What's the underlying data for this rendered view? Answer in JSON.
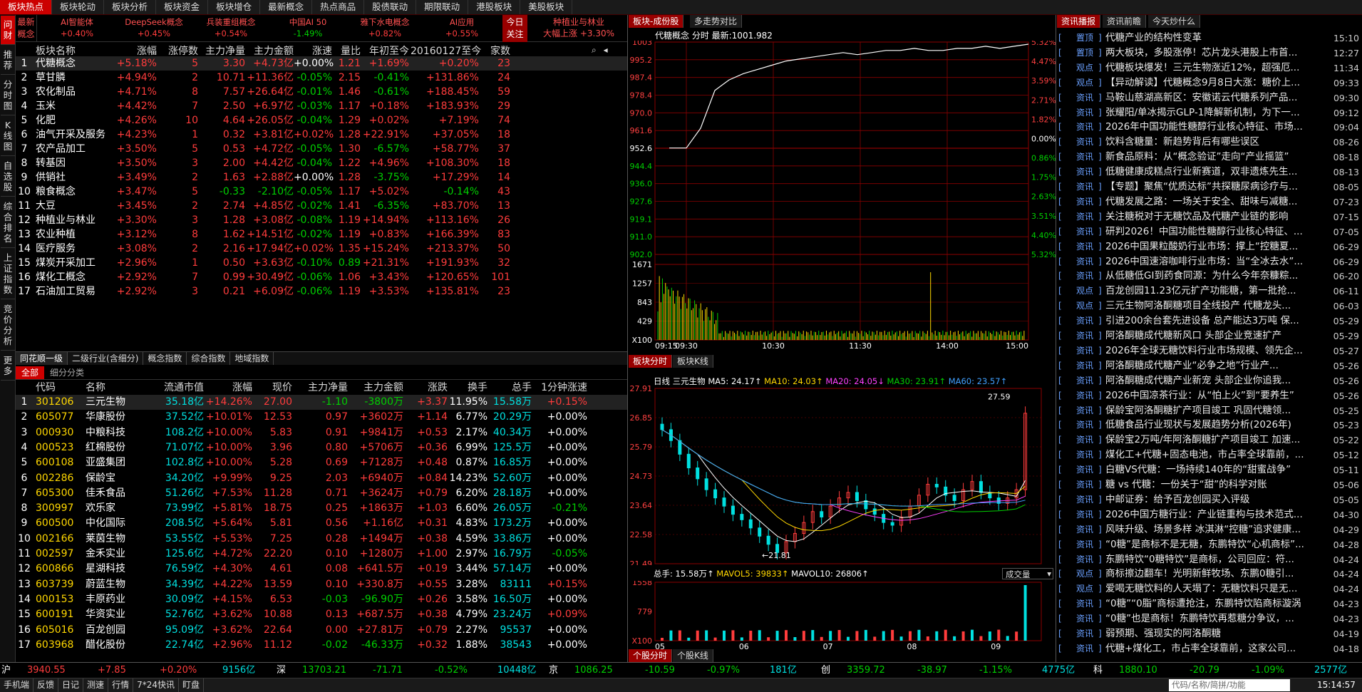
{
  "top_tabs": [
    "板块热点",
    "板块轮动",
    "板块分析",
    "板块资金",
    "板块增仓",
    "最新概念",
    "热点商品",
    "股债联动",
    "期限联动",
    "港股板块",
    "美股板块"
  ],
  "left_strip": [
    "问财",
    "推荐",
    "分时图",
    "K线图",
    "自选股",
    "综合排名",
    "上证指数",
    "竞价分析",
    "更多"
  ],
  "ticker": {
    "label": "最新概念",
    "items": [
      {
        "name": "AI智能体",
        "pct": "+0.40%"
      },
      {
        "name": "DeepSeek概念",
        "pct": "+0.45%"
      },
      {
        "name": "兵装重组概念",
        "pct": "+0.54%"
      },
      {
        "name": "中国AI 50",
        "pct": "-1.49%"
      },
      {
        "name": "雅下水电概念",
        "pct": "+0.82%"
      },
      {
        "name": "AI应用",
        "pct": "+0.55%"
      }
    ],
    "focus_label": "今日关注",
    "focus_items": [
      "种植业与林业",
      "大幅上涨 +3.30%"
    ]
  },
  "sector_table": {
    "headers": [
      "板块名称",
      "涨幅",
      "涨停数",
      "主力净量",
      "主力金额",
      "涨速",
      "量比",
      "年初至今",
      "20160127至今",
      "家数"
    ],
    "rows": [
      [
        "1",
        "代糖概念",
        "+5.18%",
        "5",
        "3.30",
        "+4.73亿",
        "+0.00%",
        "1.21",
        "+1.69%",
        "+0.20%",
        "23"
      ],
      [
        "2",
        "草甘膦",
        "+4.94%",
        "2",
        "10.71",
        "+11.36亿",
        "-0.05%",
        "2.15",
        "-0.41%",
        "+131.86%",
        "24"
      ],
      [
        "3",
        "农化制品",
        "+4.71%",
        "8",
        "7.57",
        "+26.64亿",
        "-0.01%",
        "1.46",
        "-0.61%",
        "+188.45%",
        "59"
      ],
      [
        "4",
        "玉米",
        "+4.42%",
        "7",
        "2.50",
        "+6.97亿",
        "-0.03%",
        "1.17",
        "+0.18%",
        "+183.93%",
        "29"
      ],
      [
        "5",
        "化肥",
        "+4.26%",
        "10",
        "4.64",
        "+26.05亿",
        "-0.04%",
        "1.29",
        "+0.02%",
        "+7.19%",
        "74"
      ],
      [
        "6",
        "油气开采及服务",
        "+4.23%",
        "1",
        "0.32",
        "+3.81亿",
        "+0.02%",
        "1.28",
        "+22.91%",
        "+37.05%",
        "18"
      ],
      [
        "7",
        "农产品加工",
        "+3.50%",
        "5",
        "0.53",
        "+4.72亿",
        "-0.05%",
        "1.30",
        "-6.57%",
        "+58.77%",
        "37"
      ],
      [
        "8",
        "转基因",
        "+3.50%",
        "3",
        "2.00",
        "+4.42亿",
        "-0.04%",
        "1.22",
        "+4.96%",
        "+108.30%",
        "18"
      ],
      [
        "9",
        "供销社",
        "+3.49%",
        "2",
        "1.63",
        "+2.88亿",
        "+0.00%",
        "1.28",
        "-3.75%",
        "+17.29%",
        "14"
      ],
      [
        "10",
        "粮食概念",
        "+3.47%",
        "5",
        "-0.33",
        "-2.10亿",
        "-0.05%",
        "1.17",
        "+5.02%",
        "-0.14%",
        "43"
      ],
      [
        "11",
        "大豆",
        "+3.45%",
        "2",
        "2.74",
        "+4.85亿",
        "-0.02%",
        "1.41",
        "-6.35%",
        "+83.70%",
        "13"
      ],
      [
        "12",
        "种植业与林业",
        "+3.30%",
        "3",
        "1.28",
        "+3.08亿",
        "-0.08%",
        "1.19",
        "+14.94%",
        "+113.16%",
        "26"
      ],
      [
        "13",
        "农业种植",
        "+3.12%",
        "8",
        "1.62",
        "+14.51亿",
        "-0.02%",
        "1.19",
        "+0.83%",
        "+166.39%",
        "83"
      ],
      [
        "14",
        "医疗服务",
        "+3.08%",
        "2",
        "2.16",
        "+17.94亿",
        "+0.02%",
        "1.35",
        "+15.24%",
        "+213.37%",
        "50"
      ],
      [
        "15",
        "煤炭开采加工",
        "+2.96%",
        "1",
        "0.50",
        "+3.63亿",
        "-0.10%",
        "0.89",
        "+21.31%",
        "+191.93%",
        "32"
      ],
      [
        "16",
        "煤化工概念",
        "+2.92%",
        "7",
        "0.99",
        "+30.49亿",
        "-0.06%",
        "1.06",
        "+3.43%",
        "+120.65%",
        "101"
      ],
      [
        "17",
        "石油加工贸易",
        "+2.92%",
        "3",
        "0.21",
        "+6.09亿",
        "-0.06%",
        "1.19",
        "+3.53%",
        "+135.81%",
        "23"
      ]
    ]
  },
  "sub_tabs": [
    "同花顺一级",
    "二级行业(含细分)",
    "概念指数",
    "综合指数",
    "地域指数"
  ],
  "all_tabs": [
    "全部",
    "细分分类"
  ],
  "stock_table": {
    "headers": [
      "代码",
      "名称",
      "流通市值",
      "涨幅",
      "现价",
      "主力净量",
      "主力金额",
      "涨跌",
      "换手",
      "总手",
      "1分钟涨速"
    ],
    "rows": [
      [
        "1",
        "301206",
        "三元生物",
        "35.18亿",
        "+14.26%",
        "27.00",
        "-1.10",
        "-3800万",
        "+3.37",
        "11.95%",
        "15.58万",
        "+0.15%"
      ],
      [
        "2",
        "605077",
        "华康股份",
        "37.52亿",
        "+10.01%",
        "12.53",
        "0.97",
        "+3602万",
        "+1.14",
        "6.77%",
        "20.29万",
        "+0.00%"
      ],
      [
        "3",
        "000930",
        "中粮科技",
        "108.2亿",
        "+10.00%",
        "5.83",
        "0.91",
        "+9841万",
        "+0.53",
        "2.17%",
        "40.34万",
        "+0.00%"
      ],
      [
        "4",
        "000523",
        "红棉股份",
        "71.07亿",
        "+10.00%",
        "3.96",
        "0.80",
        "+5706万",
        "+0.36",
        "6.99%",
        "125.5万",
        "+0.00%"
      ],
      [
        "5",
        "600108",
        "亚盛集团",
        "102.8亿",
        "+10.00%",
        "5.28",
        "0.69",
        "+7128万",
        "+0.48",
        "0.87%",
        "16.85万",
        "+0.00%"
      ],
      [
        "6",
        "002286",
        "保龄宝",
        "34.20亿",
        "+9.99%",
        "9.25",
        "2.03",
        "+6940万",
        "+0.84",
        "14.23%",
        "52.60万",
        "+0.00%"
      ],
      [
        "7",
        "605300",
        "佳禾食品",
        "51.26亿",
        "+7.53%",
        "11.28",
        "0.71",
        "+3624万",
        "+0.79",
        "6.20%",
        "28.18万",
        "+0.00%"
      ],
      [
        "8",
        "300997",
        "欢乐家",
        "73.99亿",
        "+5.81%",
        "18.75",
        "0.25",
        "+1863万",
        "+1.03",
        "6.60%",
        "26.05万",
        "-0.21%"
      ],
      [
        "9",
        "600500",
        "中化国际",
        "208.5亿",
        "+5.64%",
        "5.81",
        "0.56",
        "+1.16亿",
        "+0.31",
        "4.83%",
        "173.2万",
        "+0.00%"
      ],
      [
        "10",
        "002166",
        "莱茵生物",
        "53.55亿",
        "+5.53%",
        "7.25",
        "0.28",
        "+1494万",
        "+0.38",
        "4.59%",
        "33.86万",
        "+0.00%"
      ],
      [
        "11",
        "002597",
        "金禾实业",
        "125.6亿",
        "+4.72%",
        "22.20",
        "0.10",
        "+1280万",
        "+1.00",
        "2.97%",
        "16.79万",
        "-0.05%"
      ],
      [
        "12",
        "600866",
        "星湖科技",
        "76.59亿",
        "+4.30%",
        "4.61",
        "0.08",
        "+641.5万",
        "+0.19",
        "3.44%",
        "57.14万",
        "+0.00%"
      ],
      [
        "13",
        "603739",
        "蔚蓝生物",
        "34.39亿",
        "+4.22%",
        "13.59",
        "0.10",
        "+330.8万",
        "+0.55",
        "3.28%",
        "83111",
        "+0.15%"
      ],
      [
        "14",
        "000153",
        "丰原药业",
        "30.09亿",
        "+4.15%",
        "6.53",
        "-0.03",
        "-96.90万",
        "+0.26",
        "3.58%",
        "16.50万",
        "+0.00%"
      ],
      [
        "15",
        "600191",
        "华资实业",
        "52.76亿",
        "+3.62%",
        "10.88",
        "0.13",
        "+687.5万",
        "+0.38",
        "4.79%",
        "23.24万",
        "+0.09%"
      ],
      [
        "16",
        "605016",
        "百龙创园",
        "95.09亿",
        "+3.62%",
        "22.64",
        "0.00",
        "+27.81万",
        "+0.79",
        "2.27%",
        "95537",
        "+0.00%"
      ],
      [
        "17",
        "603968",
        "醋化股份",
        "22.74亿",
        "+2.96%",
        "11.12",
        "-0.02",
        "-46.33万",
        "+0.32",
        "1.88%",
        "38543",
        "+0.00%"
      ]
    ]
  },
  "chart_panel": {
    "tabs_top": [
      "板块-成份股",
      "多走势对比"
    ],
    "intraday_title": "代糖概念 分时 最新:1001.982",
    "tabs_mid": [
      "板块分时",
      "板块K线"
    ],
    "tabs_bottom": [
      "个股分时",
      "个股K线"
    ],
    "kline_legend": {
      "prefix": "日线 三元生物",
      "ma5": "MA5: 24.17↑",
      "ma10": "MA10: 24.03↑",
      "ma20": "MA20: 24.05↓",
      "ma30": "MA30: 23.91↑",
      "ma60": "MA60: 23.57↑"
    },
    "vol_legend": {
      "total": "总手: 15.58万↑",
      "mavol5": "MAVOL5: 39833↑",
      "mavol10": "MAVOL10: 26806↑",
      "select": "成交量"
    },
    "vol_x100": "X100",
    "kline_hi": "27.59",
    "kline_lo": "21.81"
  },
  "chart_data": [
    {
      "type": "line",
      "title": "代糖概念 分时",
      "x_ticks": [
        "09:15",
        "09:30",
        "10:30",
        "11:30",
        "14:00",
        "15:00"
      ],
      "y_left": [
        "1003",
        "995.2",
        "987.4",
        "978.4",
        "970.0",
        "961.6",
        "952.6",
        "944.4",
        "936.0",
        "927.6",
        "919.1",
        "911.0",
        "902.0"
      ],
      "y_right": [
        "5.32%",
        "4.47%",
        "3.59%",
        "2.71%",
        "1.82%",
        "0.00%",
        "0.86%",
        "1.75%",
        "2.63%",
        "3.51%",
        "4.40%",
        "5.32%"
      ],
      "series": [
        {
          "values": [
            952.6,
            962,
            980,
            985,
            988,
            990,
            992,
            994,
            995,
            996,
            997,
            998,
            997,
            998,
            999,
            999,
            1000,
            999,
            999,
            1000,
            1000,
            1001,
            1000,
            1001,
            1002
          ]
        }
      ],
      "volume_y": [
        "1671",
        "1257",
        "843",
        "429",
        "X100"
      ]
    },
    {
      "type": "candlestick",
      "title": "日线 三元生物",
      "y_ticks": [
        "27.91",
        "26.85",
        "25.79",
        "24.73",
        "23.64",
        "22.58",
        "21.49"
      ],
      "x_ticks": [
        "05",
        "06",
        "07",
        "08",
        "09"
      ],
      "closes": [
        26.4,
        26.0,
        25.5,
        25.0,
        24.6,
        24.2,
        23.9,
        23.6,
        23.3,
        23.1,
        22.8,
        22.5,
        22.2,
        21.9,
        22.3,
        22.6,
        23.0,
        23.4,
        23.2,
        23.6,
        23.9,
        24.1,
        23.8,
        23.5,
        23.3,
        23.0,
        22.9,
        23.2,
        23.6,
        24.0,
        24.4,
        24.3,
        24.0,
        23.8,
        24.2,
        24.5,
        24.1,
        23.9,
        23.7,
        23.9,
        24.2,
        27.0
      ],
      "volume_y": [
        "1558",
        "779",
        "X100"
      ]
    }
  ],
  "news_panel": {
    "tabs": [
      "资讯播报",
      "资讯前瞻",
      "今天炒什么"
    ],
    "items": [
      [
        "置顶",
        "代糖产业的结构性变革",
        "15:10"
      ],
      [
        "置顶",
        "两大板块，多股涨停！芯片龙头港股上市首...",
        "12:27"
      ],
      [
        "观点",
        "代糖板块爆发！三元生物涨近12%，超强厄...",
        "11:34"
      ],
      [
        "观点",
        "【异动解读】代糖概念9月8日大涨：糖价上...",
        "09:33"
      ],
      [
        "资讯",
        "马鞍山慈湖高新区：安徽诺云代糖系列产品...",
        "09:30"
      ],
      [
        "资讯",
        "张耀阳/单冰揭示GLP-1降解新机制，为下一...",
        "09:12"
      ],
      [
        "资讯",
        "2026年中国功能性糖醇行业核心特征、市场...",
        "09:04"
      ],
      [
        "资讯",
        "饮料含糖量：新趋势背后有哪些误区",
        "08-26"
      ],
      [
        "资讯",
        "新食品原料：从“概念验证”走向“产业摇篮”",
        "08-18"
      ],
      [
        "资讯",
        "低糖健康成糕点行业新赛道，双非遗炼先生...",
        "08-13"
      ],
      [
        "资讯",
        "【专题】聚焦“优质达标”共探糖尿病诊疗与...",
        "08-05"
      ],
      [
        "资讯",
        "代糖发展之路：一场关于安全、甜味与减糖...",
        "07-23"
      ],
      [
        "资讯",
        "关注糖税对于无糖饮品及代糖产业链的影响",
        "07-15"
      ],
      [
        "资讯",
        "研判2026！中国功能性糖醇行业核心特征、...",
        "07-05"
      ],
      [
        "资讯",
        "2026中国果粒酸奶行业市场：撑上“控糖夏...",
        "06-29"
      ],
      [
        "资讯",
        "2026中国速溶咖啡行业市场：当“全冰去水”...",
        "06-29"
      ],
      [
        "资讯",
        "从低糖低GI到药食同源：为什么今年奈糠粽...",
        "06-20"
      ],
      [
        "观点",
        "百龙创园11.23亿元扩产功能糖，第一批抢...",
        "06-11"
      ],
      [
        "观点",
        "三元生物阿洛酮糖项目全线投产 代糖龙头...",
        "06-03"
      ],
      [
        "资讯",
        "引进200余台套先进设备 总产能达3万吨 保...",
        "05-29"
      ],
      [
        "资讯",
        "阿洛酮糖成代糖新风口 头部企业竞速扩产",
        "05-29"
      ],
      [
        "资讯",
        "2026年全球无糖饮料行业市场规模、领先企...",
        "05-27"
      ],
      [
        "资讯",
        "阿洛酮糖成代糖产业“必争之地”行业产...",
        "05-26"
      ],
      [
        "资讯",
        "阿洛酮糖成代糖产业新宠 头部企业你追我...",
        "05-26"
      ],
      [
        "资讯",
        "2026中国凉茶行业：从“怕上火”到“要养生”",
        "05-26"
      ],
      [
        "资讯",
        "保龄宝阿洛酮糖扩产项目竣工 巩固代糖领...",
        "05-25"
      ],
      [
        "资讯",
        "低糖食品行业现状与发展趋势分析(2026年)",
        "05-23"
      ],
      [
        "资讯",
        "保龄宝2万吨/年阿洛酮糖扩产项目竣工 加速...",
        "05-22"
      ],
      [
        "资讯",
        "煤化工+代糖+固态电池，市占率全球靠前，...",
        "05-12"
      ],
      [
        "资讯",
        "白糖VS代糖：一场持续140年的“甜蜜战争”",
        "05-11"
      ],
      [
        "资讯",
        "糖 vs 代糖：一份关于“甜”的科学对账",
        "05-06"
      ],
      [
        "资讯",
        "中邮证券：给予百龙创园买入评级",
        "05-05"
      ],
      [
        "资讯",
        "2026中国方糖行业：产业链重构与技术范式...",
        "04-30"
      ],
      [
        "资讯",
        "风味升级、场景多样 冰淇淋“控糖”追求健康...",
        "04-29"
      ],
      [
        "资讯",
        "“0糖”是商标不是无糖，东鹏特饮“心机商标”...",
        "04-28"
      ],
      [
        "资讯",
        "东鹏特饮“0糖特饮”是商标，公司回应：符...",
        "04-24"
      ],
      [
        "观点",
        "商标擦边翻车！光明新鲜牧场、东鹏0糖引...",
        "04-24"
      ],
      [
        "观点",
        "爱喝无糖饮料的人天塌了：无糖饮料只是无...",
        "04-24"
      ],
      [
        "资讯",
        "“0糖”“0脂”商标遭抢注，东鹏特饮陷商标漩涡",
        "04-23"
      ],
      [
        "资讯",
        "“0糖”也是商标！东鹏特饮再惹糖分争议，...",
        "04-23"
      ],
      [
        "资讯",
        "弱预期、强现实的阿洛酮糖",
        "04-19"
      ],
      [
        "资讯",
        "代糖+煤化工，市占率全球靠前，这家公司...",
        "04-18"
      ]
    ]
  },
  "status": {
    "sh": {
      "label": "沪",
      "v": "3940.55",
      "c": "+7.85",
      "p": "+0.20%",
      "amt": "9156亿"
    },
    "sz": {
      "label": "深",
      "v": "13703.21",
      "c": "-71.71",
      "p": "-0.52%",
      "amt": "10448亿"
    },
    "bj": {
      "label": "京",
      "v": "1086.25",
      "c": "-10.59",
      "p": "-0.97%",
      "amt": "181亿"
    },
    "cy": {
      "label": "创",
      "v": "3359.72",
      "c": "-38.97",
      "p": "-1.15%",
      "amt": "4775亿"
    },
    "kc": {
      "label": "科",
      "v": "1880.10",
      "c": "-20.79",
      "p": "-1.09%",
      "amt": "2577亿"
    }
  },
  "bottom": {
    "items": [
      "手机端",
      "反馈",
      "日记",
      "测速",
      "行情",
      "7*24快讯",
      "盯盘"
    ],
    "search_placeholder": "代码/名称/简拼/功能",
    "time": "15:14:57"
  }
}
